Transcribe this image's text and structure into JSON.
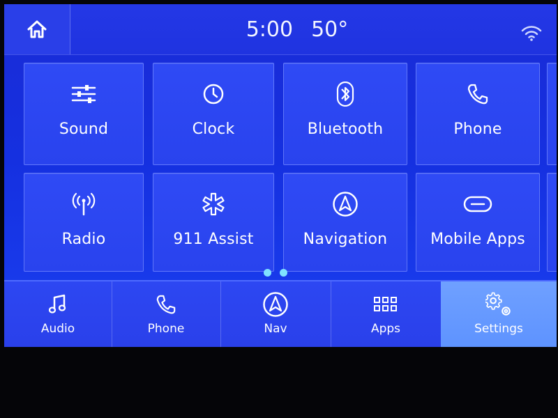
{
  "status": {
    "time": "5:00",
    "temperature": "50°",
    "home_icon": "home-icon",
    "wifi_icon": "wifi-icon"
  },
  "tiles": [
    {
      "label": "Sound",
      "icon": "sliders-icon"
    },
    {
      "label": "Clock",
      "icon": "clock-icon"
    },
    {
      "label": "Bluetooth",
      "icon": "bluetooth-icon"
    },
    {
      "label": "Phone",
      "icon": "phone-icon"
    },
    {
      "label": "Radio",
      "icon": "antenna-icon"
    },
    {
      "label": "911 Assist",
      "icon": "medical-star-icon"
    },
    {
      "label": "Navigation",
      "icon": "navigation-arrow-icon"
    },
    {
      "label": "Mobile Apps",
      "icon": "link-icon"
    }
  ],
  "pagination": {
    "pages": 2,
    "current": 1
  },
  "nav": [
    {
      "label": "Audio",
      "icon": "music-note-icon",
      "active": false
    },
    {
      "label": "Phone",
      "icon": "phone-icon",
      "active": false
    },
    {
      "label": "Nav",
      "icon": "navigation-arrow-icon",
      "active": false
    },
    {
      "label": "Apps",
      "icon": "apps-grid-icon",
      "active": false
    },
    {
      "label": "Settings",
      "icon": "gears-icon",
      "active": true
    }
  ],
  "colors": {
    "background": "#1a2bd6",
    "tile": "#2f4af5",
    "active_tab": "#6fa0ff",
    "page_dot": "#7fe3ff"
  }
}
